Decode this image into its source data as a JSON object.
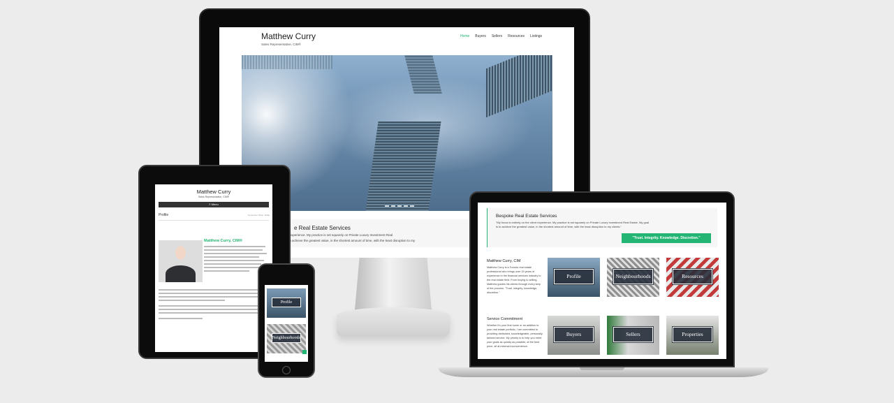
{
  "desktop": {
    "site_name": "Matthew Curry",
    "tagline": "Sales Representative, CIM®",
    "nav": [
      "Home",
      "Buyers",
      "Sellers",
      "Resources",
      "Listings"
    ],
    "intro_title": "e Real Estate Services",
    "intro_line1": "ient experience. My practice is set squarely on Private Luxury Investment Real",
    "intro_line2": "I is to achieve the greatest value, in the shortest amount of time, with the least disruption to my"
  },
  "tablet": {
    "site_name": "Matthew Curry",
    "tagline": "Sales Representative, CIM®",
    "menu_label": "≡ Menu",
    "page_title": "Profile",
    "breadcrumb": "You are here: Home › Profile",
    "heading": "Matthew Curry, CIM®"
  },
  "phone": {
    "tiles": [
      "Profile",
      "Neighbourhoods"
    ]
  },
  "laptop": {
    "box_title": "Bespoke Real Estate Services",
    "box_text": "\"My focus is entirely on the client experience. My practice is set squarely on Private Luxury Investment Real Estate. My goal is to achieve the greatest value, in the shortest amount of time, with the least disruption to my clients.\"",
    "quote_button": "\"Trust. Integrity. Knowledge. Discretion.\"",
    "about_heading": "Matthew Curry, CIM",
    "about_text": "Matthew Curry is a Toronto real estate professional who brings over 15 years of experience in the financial services industry to the real estate field. From buying to selling, Matthew guides his clients through every step of the process. \"Trust, integrity, knowledge, discretion.\"",
    "service_heading": "Service Commitment",
    "service_text": "Whether it's your first home or an addition to your real estate portfolio, I am committed to providing dedicated, knowledgeable, personally tailored service. My priority is to help you meet your goals as quickly as possible, at the best price, all at minimal inconvenience.",
    "tiles": [
      "Profile",
      "Neighbourhoods",
      "Resources",
      "Buyers",
      "Sellers",
      "Properties"
    ]
  },
  "colors": {
    "accent": "#22b573",
    "device_frame": "#0c0c0c",
    "background": "#ececec"
  }
}
